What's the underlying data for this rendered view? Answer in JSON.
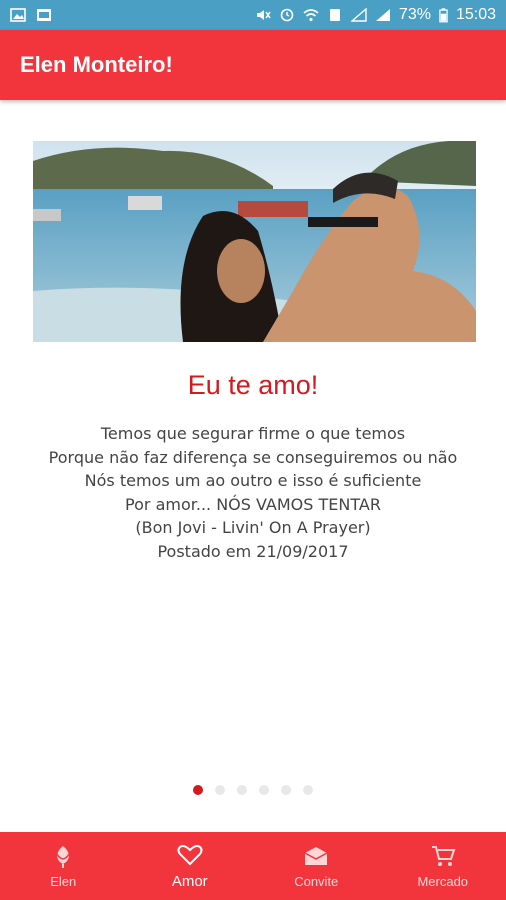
{
  "status_bar": {
    "battery": "73%",
    "time": "15:03"
  },
  "appbar": {
    "title": "Elen Monteiro!"
  },
  "content": {
    "headline": "Eu te amo!",
    "lines": [
      "Temos que segurar firme o que temos",
      "Porque não faz diferença se conseguiremos ou não",
      "Nós temos um ao outro e isso é suficiente",
      "Por amor... NÓS VAMOS TENTAR",
      "(Bon Jovi - Livin' On A Prayer)",
      "Postado em 21/09/2017"
    ]
  },
  "pager": {
    "count": 6,
    "active_index": 0
  },
  "bottom_nav": {
    "items": [
      {
        "label": "Elen",
        "icon": "rose-icon"
      },
      {
        "label": "Amor",
        "icon": "heart-icon"
      },
      {
        "label": "Convite",
        "icon": "envelope-icon"
      },
      {
        "label": "Mercado",
        "icon": "cart-icon"
      }
    ],
    "active_index": 1
  },
  "colors": {
    "primary": "#f2353d",
    "accent": "#d4191f",
    "status": "#4a9fc4"
  }
}
